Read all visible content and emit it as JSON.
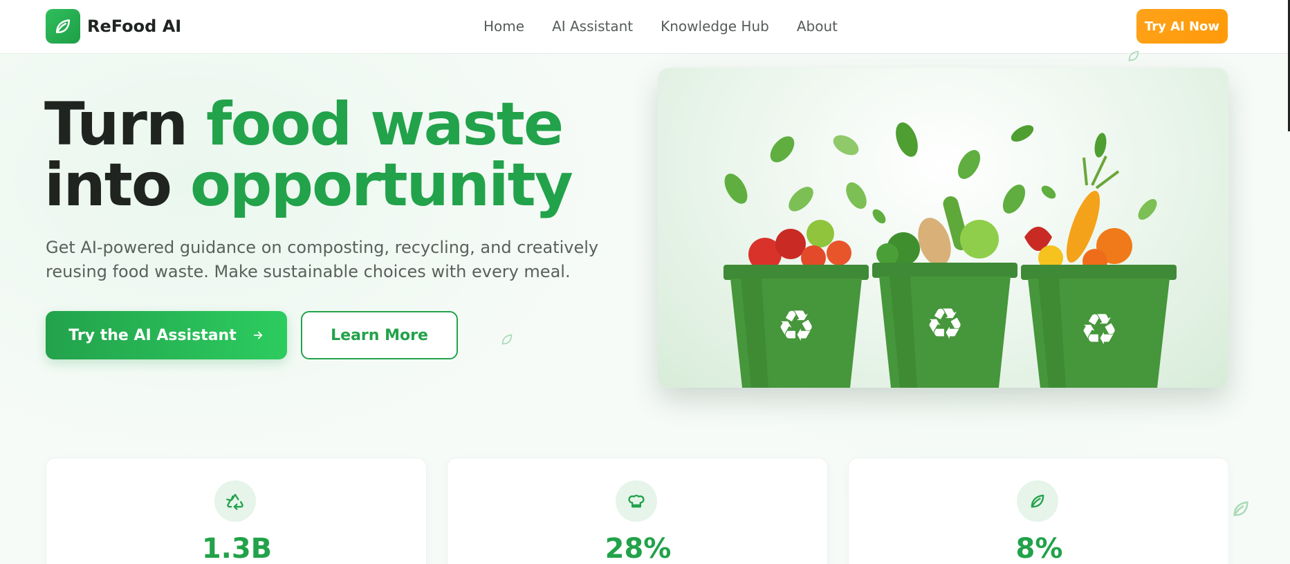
{
  "brand": {
    "name": "ReFood AI",
    "logo_icon": "leaf-icon",
    "accent": "#22a24a",
    "cta_color": "#ff9f10"
  },
  "nav": {
    "links": [
      "Home",
      "AI Assistant",
      "Knowledge Hub",
      "About"
    ],
    "cta_label": "Try AI Now"
  },
  "hero": {
    "title_part1": "Turn ",
    "title_accent1": "food waste",
    "title_part2": "into ",
    "title_accent2": "opportunity",
    "subtitle": "Get AI-powered guidance on composting, recycling, and creatively reusing food waste. Make sustainable choices with every meal.",
    "primary_button": "Try the AI Assistant",
    "primary_button_icon": "arrow-right-icon",
    "secondary_button": "Learn More",
    "image_subject": "three-green-recycling-bins-with-vegetables"
  },
  "stats": [
    {
      "icon": "recycle-icon",
      "value": "1.3B"
    },
    {
      "icon": "chef-hat-icon",
      "value": "28%"
    },
    {
      "icon": "leaf-icon",
      "value": "8%"
    }
  ]
}
